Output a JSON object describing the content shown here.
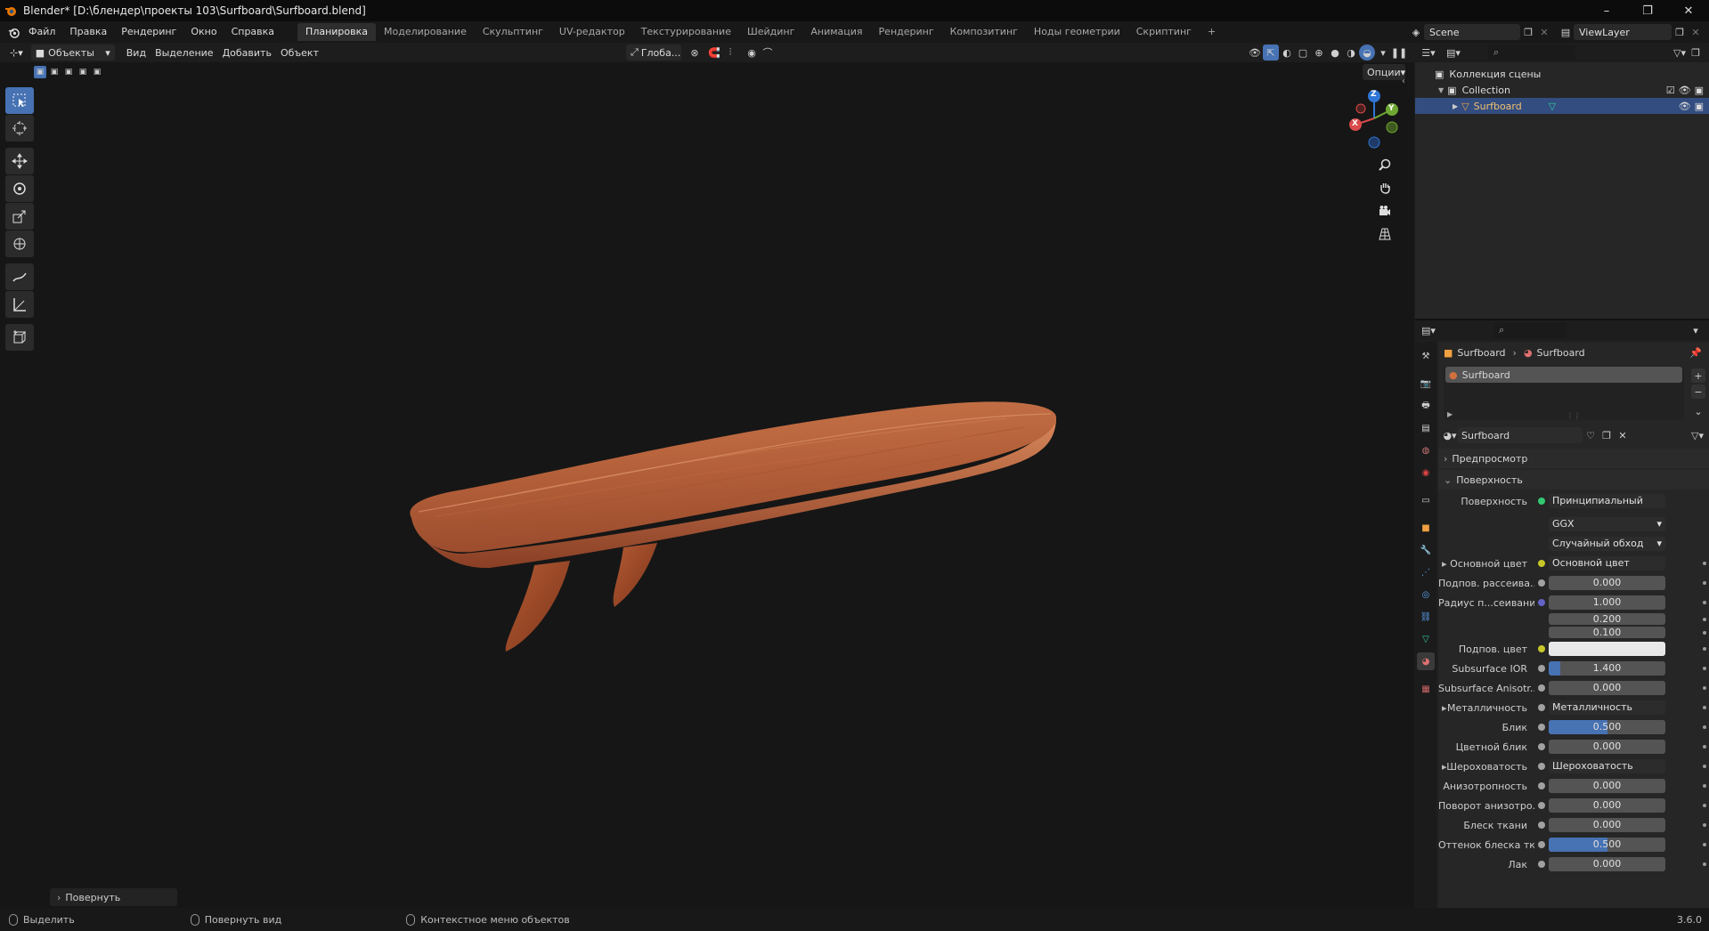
{
  "window": {
    "title": "Blender* [D:\\блендер\\проекты 103\\Surfboard\\Surfboard.blend]",
    "minimize": "–",
    "maximize": "❐",
    "close": "✕"
  },
  "menu": [
    "Файл",
    "Правка",
    "Рендеринг",
    "Окно",
    "Справка"
  ],
  "workspaces": {
    "active": "Планировка",
    "tabs": [
      "Планировка",
      "Моделирование",
      "Скульптинг",
      "UV-редактор",
      "Текстурирование",
      "Шейдинг",
      "Анимация",
      "Рендеринг",
      "Композитинг",
      "Ноды геометрии",
      "Скриптинг"
    ],
    "add": "+"
  },
  "scene": {
    "name": "Scene",
    "view_layer": "ViewLayer"
  },
  "viewport_header": {
    "mode": "Объекты",
    "menus": [
      "Вид",
      "Выделение",
      "Добавить",
      "Объект"
    ],
    "transform_orientation": "Глоба...",
    "options": "Опции"
  },
  "viewport": {
    "gizmo": {
      "x": "X",
      "y": "Y",
      "z": "Z"
    },
    "last_operator": "Повернуть"
  },
  "outliner": {
    "scene_collection": "Коллекция сцены",
    "collection": "Collection",
    "object": "Surfboard"
  },
  "properties": {
    "breadcrumb_object": "Surfboard",
    "breadcrumb_material": "Surfboard",
    "material_slot": "Surfboard",
    "material_name": "Surfboard",
    "panel_preview": "Предпросмотр",
    "panel_surface": "Поверхность",
    "surface_label": "Поверхность",
    "surface_value": "Принципиальный BSDF",
    "distribution": "GGX",
    "subsurface_method": "Случайный обход",
    "rows": [
      {
        "label": "Основной цвет",
        "value": "Основной цвет",
        "type": "link",
        "expand": true,
        "socket": "#c7c729"
      },
      {
        "label": "Подпов. рассеива...",
        "value": "0.000",
        "type": "num",
        "fill": 0,
        "socket": "#a1a1a1"
      },
      {
        "label": "Радиус п...сеивания",
        "value": "1.000",
        "type": "num",
        "fill": 0,
        "socket": "#6363c7"
      },
      {
        "label": "",
        "value": "0.200",
        "type": "num",
        "fill": 0,
        "socket": ""
      },
      {
        "label": "",
        "value": "0.100",
        "type": "num",
        "fill": 0,
        "socket": ""
      },
      {
        "label": "Подпов. цвет",
        "value": "",
        "type": "color",
        "color": "#e8e8e8",
        "socket": "#c7c729"
      },
      {
        "label": "Subsurface IOR",
        "value": "1.400",
        "type": "num",
        "fill": 0.1,
        "socket": "#a1a1a1"
      },
      {
        "label": "Subsurface Anisotr...",
        "value": "0.000",
        "type": "num",
        "fill": 0,
        "socket": "#a1a1a1"
      },
      {
        "label": "Металличность",
        "value": "Металличность",
        "type": "link",
        "expand": true,
        "socket": "#a1a1a1"
      },
      {
        "label": "Блик",
        "value": "0.500",
        "type": "num",
        "fill": 0.5,
        "socket": "#a1a1a1"
      },
      {
        "label": "Цветной блик",
        "value": "0.000",
        "type": "num",
        "fill": 0,
        "socket": "#a1a1a1"
      },
      {
        "label": "Шероховатость",
        "value": "Шероховатость",
        "type": "link",
        "expand": true,
        "socket": "#a1a1a1"
      },
      {
        "label": "Анизотропность",
        "value": "0.000",
        "type": "num",
        "fill": 0,
        "socket": "#a1a1a1"
      },
      {
        "label": "Поворот анизотро...",
        "value": "0.000",
        "type": "num",
        "fill": 0,
        "socket": "#a1a1a1"
      },
      {
        "label": "Блеск ткани",
        "value": "0.000",
        "type": "num",
        "fill": 0,
        "socket": "#a1a1a1"
      },
      {
        "label": "Оттенок блеска тк...",
        "value": "0.500",
        "type": "num",
        "fill": 0.5,
        "socket": "#a1a1a1"
      },
      {
        "label": "Лак",
        "value": "0.000",
        "type": "num",
        "fill": 0,
        "socket": "#a1a1a1"
      }
    ]
  },
  "statusbar": {
    "select": "Выделить",
    "rotate_view": "Повернуть вид",
    "context_menu": "Контекстное меню объектов",
    "version": "3.6.0"
  },
  "colors": {
    "accent": "#4772b3",
    "selected_row": "#334d80",
    "board_wood": "#b5603a"
  }
}
